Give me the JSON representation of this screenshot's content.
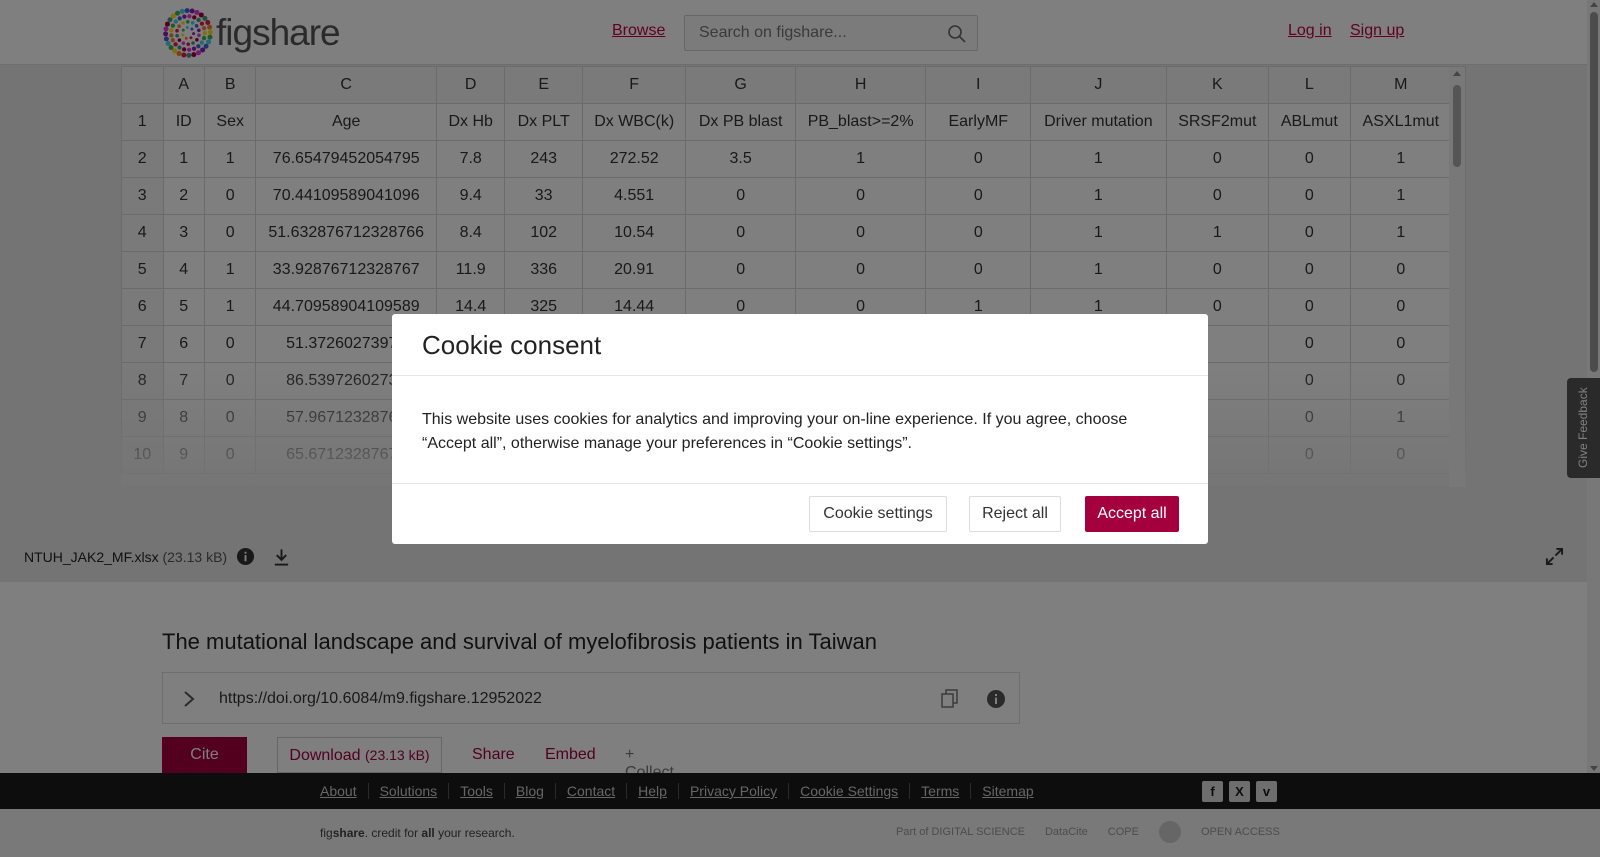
{
  "header": {
    "logo_text": "figshare",
    "browse_label": "Browse",
    "search_placeholder": "Search on figshare...",
    "login_label": "Log in",
    "signup_label": "Sign up"
  },
  "spreadsheet": {
    "column_letters": [
      "",
      "A",
      "B",
      "C",
      "D",
      "E",
      "F",
      "G",
      "H",
      "I",
      "J",
      "K",
      "L",
      "M"
    ],
    "rows": [
      [
        "1",
        "ID",
        "Sex",
        "Age",
        "Dx Hb",
        "Dx PLT",
        "Dx WBC(k)",
        "Dx PB blast",
        "PB_blast>=2%",
        "EarlyMF",
        "Driver mutation",
        "SRSF2mut",
        "ABLmut",
        "ASXL1mut"
      ],
      [
        "2",
        "1",
        "1",
        "76.65479452054795",
        "7.8",
        "243",
        "272.52",
        "3.5",
        "1",
        "0",
        "1",
        "0",
        "0",
        "1"
      ],
      [
        "3",
        "2",
        "0",
        "70.44109589041096",
        "9.4",
        "33",
        "4.551",
        "0",
        "0",
        "0",
        "1",
        "0",
        "0",
        "1"
      ],
      [
        "4",
        "3",
        "0",
        "51.632876712328766",
        "8.4",
        "102",
        "10.54",
        "0",
        "0",
        "0",
        "1",
        "1",
        "0",
        "1"
      ],
      [
        "5",
        "4",
        "1",
        "33.92876712328767",
        "11.9",
        "336",
        "20.91",
        "0",
        "0",
        "0",
        "1",
        "0",
        "0",
        "0"
      ],
      [
        "6",
        "5",
        "1",
        "44.70958904109589",
        "14.4",
        "325",
        "14.44",
        "0",
        "0",
        "1",
        "1",
        "0",
        "0",
        "0"
      ],
      [
        "7",
        "6",
        "0",
        "51.37260273972",
        "",
        "",
        "",
        "",
        "",
        "",
        "",
        "",
        "0",
        "0"
      ],
      [
        "8",
        "7",
        "0",
        "86.53972602739",
        "",
        "",
        "",
        "",
        "",
        "",
        "",
        "",
        "0",
        "0"
      ],
      [
        "9",
        "8",
        "0",
        "57.96712328767",
        "",
        "",
        "",
        "",
        "",
        "",
        "",
        "",
        "0",
        "1"
      ],
      [
        "10",
        "9",
        "0",
        "65.67123287671",
        "",
        "",
        "",
        "",
        "",
        "",
        "",
        "",
        "0",
        "0"
      ]
    ]
  },
  "file": {
    "name": "NTUH_JAK2_MF.xlsx",
    "size": "(23.13 kB)"
  },
  "feedback_label": "Give Feedback",
  "item": {
    "title": "The mutational landscape and survival of myelofibrosis patients in Taiwan",
    "doi": "https://doi.org/10.6084/m9.figshare.12952022"
  },
  "actions": {
    "cite": "Cite",
    "download": "Download",
    "download_size": "(23.13 kB)",
    "share": "Share",
    "embed": "Embed",
    "collect": "+ Collect"
  },
  "footer": {
    "links": [
      "About",
      "Solutions",
      "Tools",
      "Blog",
      "Contact",
      "Help",
      "Privacy Policy",
      "Cookie Settings",
      "Terms",
      "Sitemap"
    ],
    "social": [
      "f",
      "X",
      "v"
    ],
    "tagline_brand_a": "fig",
    "tagline_brand_b": "share",
    "tagline_mid": ". credit for ",
    "tagline_all": "all",
    "tagline_end": " your research.",
    "partners": [
      "Part of DIGITAL SCIENCE",
      "DataCite",
      "COPE",
      "",
      "OPEN ACCESS"
    ]
  },
  "cookie_modal": {
    "title": "Cookie consent",
    "body": "This website uses cookies for analytics and improving your on-line experience. If you agree, choose “Accept all”, otherwise manage your preferences in “Cookie settings”.",
    "settings_label": "Cookie settings",
    "reject_label": "Reject all",
    "accept_label": "Accept all"
  },
  "colors": {
    "brand": "#a4003d",
    "link": "#c40043"
  }
}
